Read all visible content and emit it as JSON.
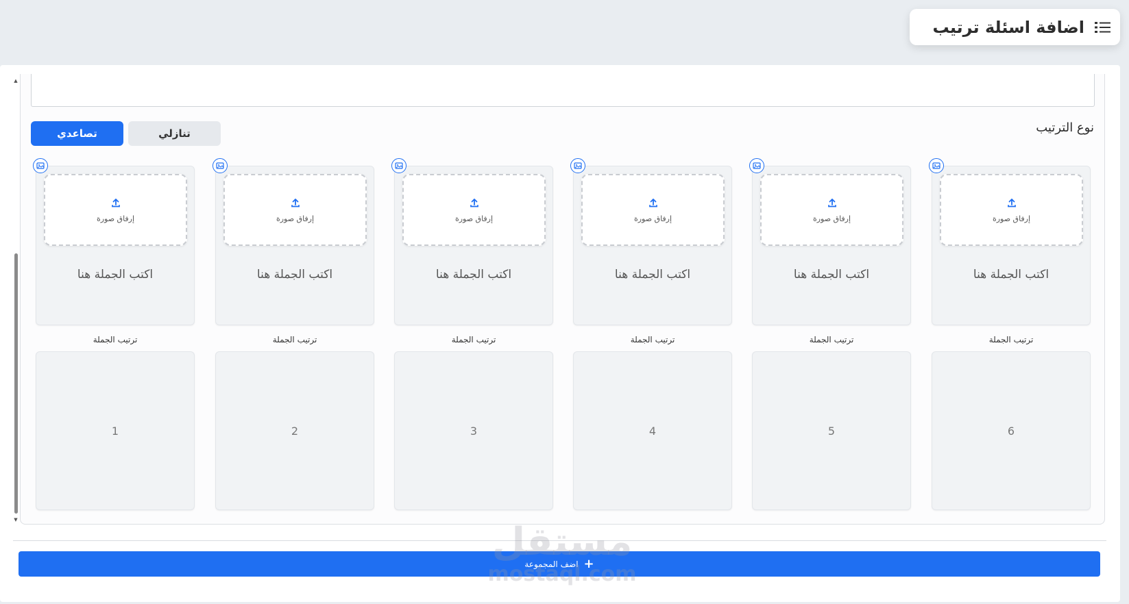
{
  "header": {
    "title": "اضافة اسئلة ترتيب",
    "icon": "list-icon"
  },
  "sort_type": {
    "label": "نوع الترتيب",
    "ascending_label": "تصاعدي",
    "descending_label": "تنازلي",
    "active": "ascending"
  },
  "cards": [
    {
      "upload_label": "إرفاق صورة",
      "sentence_placeholder": "اكتب الجملة هنا",
      "order_label": "ترتيب الجملة",
      "order_value": "6"
    },
    {
      "upload_label": "إرفاق صورة",
      "sentence_placeholder": "اكتب الجملة هنا",
      "order_label": "ترتيب الجملة",
      "order_value": "5"
    },
    {
      "upload_label": "إرفاق صورة",
      "sentence_placeholder": "اكتب الجملة هنا",
      "order_label": "ترتيب الجملة",
      "order_value": "4"
    },
    {
      "upload_label": "إرفاق صورة",
      "sentence_placeholder": "اكتب الجملة هنا",
      "order_label": "ترتيب الجملة",
      "order_value": "3"
    },
    {
      "upload_label": "إرفاق صورة",
      "sentence_placeholder": "اكتب الجملة هنا",
      "order_label": "ترتيب الجملة",
      "order_value": "2"
    },
    {
      "upload_label": "إرفاق صورة",
      "sentence_placeholder": "اكتب الجملة هنا",
      "order_label": "ترتيب الجملة",
      "order_value": "1"
    }
  ],
  "footer": {
    "add_group_label": "اضف المجموعة"
  },
  "watermark": {
    "arabic": "مستقل",
    "latin": "mostaql.com"
  },
  "colors": {
    "primary": "#1f6ff2",
    "background": "#e9edf1",
    "card": "#f1f3f5"
  }
}
